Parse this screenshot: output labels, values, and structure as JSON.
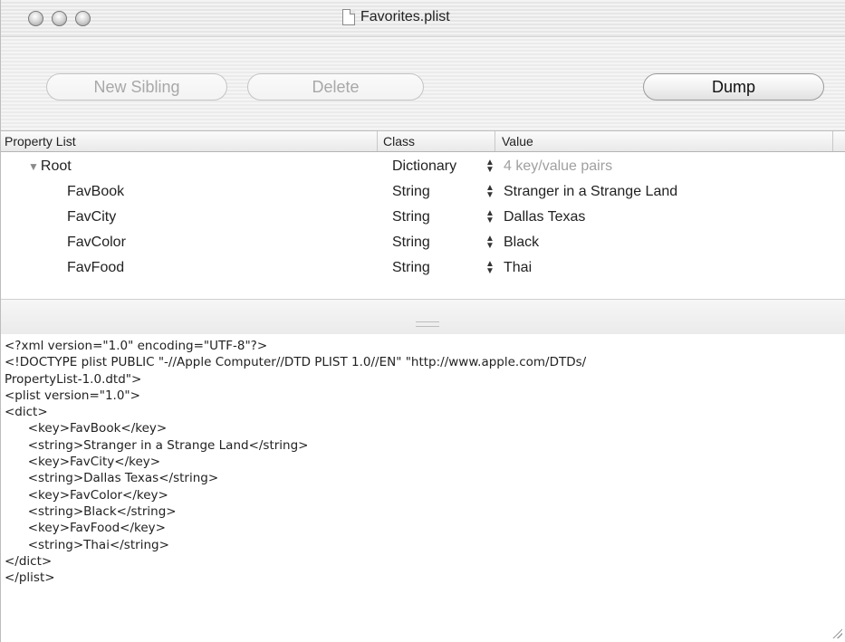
{
  "window": {
    "title": "Favorites.plist"
  },
  "toolbar": {
    "new_sibling_label": "New Sibling",
    "delete_label": "Delete",
    "dump_label": "Dump"
  },
  "outline": {
    "columns": [
      "Property List",
      "Class",
      "Value"
    ],
    "root": {
      "key": "Root",
      "class": "Dictionary",
      "value": "4 key/value pairs"
    },
    "rows": [
      {
        "key": "FavBook",
        "class": "String",
        "value": "Stranger in a Strange Land"
      },
      {
        "key": "FavCity",
        "class": "String",
        "value": "Dallas Texas"
      },
      {
        "key": "FavColor",
        "class": "String",
        "value": "Black"
      },
      {
        "key": "FavFood",
        "class": "String",
        "value": "Thai"
      }
    ]
  },
  "xml_text": "<?xml version=\"1.0\" encoding=\"UTF-8\"?>\n<!DOCTYPE plist PUBLIC \"-//Apple Computer//DTD PLIST 1.0//EN\" \"http://www.apple.com/DTDs/\nPropertyList-1.0.dtd\">\n<plist version=\"1.0\">\n<dict>\n      <key>FavBook</key>\n      <string>Stranger in a Strange Land</string>\n      <key>FavCity</key>\n      <string>Dallas Texas</string>\n      <key>FavColor</key>\n      <string>Black</string>\n      <key>FavFood</key>\n      <string>Thai</string>\n</dict>\n</plist>",
  "icons": {
    "close": "close-traffic-light",
    "minimize": "minimize-traffic-light",
    "zoom": "zoom-traffic-light",
    "document": "document-icon",
    "disclosure": "▼",
    "stepper": "⬍"
  }
}
